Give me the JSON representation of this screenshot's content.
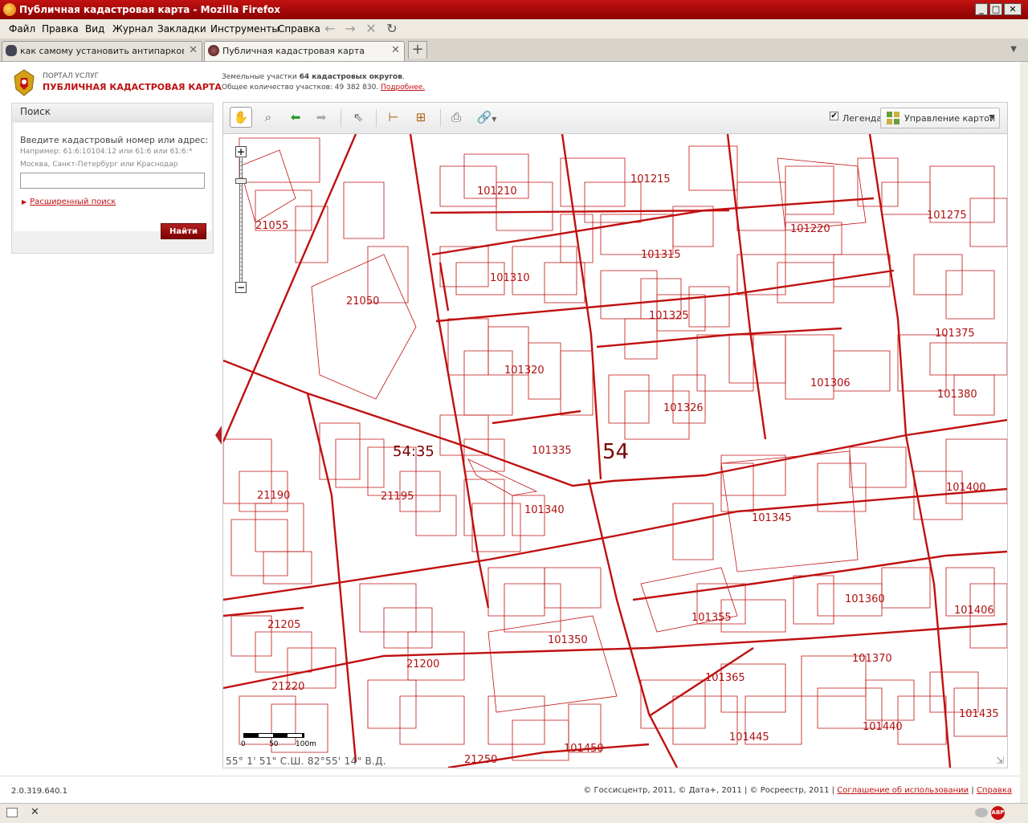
{
  "window": {
    "title": "Публичная кадастровая карта - Mozilla Firefox",
    "controls": [
      "_",
      "□",
      "✕"
    ]
  },
  "menu": {
    "items": [
      "Файл",
      "Правка",
      "Вид",
      "Журнал",
      "Закладки",
      "Инструменты",
      "Справка"
    ]
  },
  "address": {
    "url": "http://maps.rosreestr.ru/Portal/"
  },
  "tabs": [
    {
      "label": "как самому установить антипарковоч...",
      "active": false
    },
    {
      "label": "Публичная кадастровая карта",
      "active": true
    }
  ],
  "header": {
    "portal_line1": "ПОРТАЛ УСЛУГ",
    "portal_line2": "ПУБЛИЧНАЯ КАДАСТРОВАЯ КАРТА",
    "stats_prefix": "Земельные участки",
    "stats_bold": "64 кадастровых округов",
    "stats_suffix": ".",
    "count_text": "Общее количество участков: 49 382 830.",
    "details_link": "Подробнее."
  },
  "search": {
    "heading": "Поиск",
    "prompt": "Введите кадастровый номер или адрес:",
    "example1": "Например: 61:6:10104:12 или 61:6 или 61:6:*",
    "example2": "Москва, Санкт-Петербург или Краснодар",
    "input_value": "",
    "advanced_link": "Расширенный поиск",
    "submit_label": "Найти"
  },
  "toolbar": {
    "legend_label": "Легенда",
    "legend_checked": true,
    "legend_check_glyph": "✔",
    "map_control_label": "Управление картой",
    "tools": [
      {
        "name": "pan-tool",
        "glyph": "✋",
        "selected": true
      },
      {
        "name": "zoom-box-tool",
        "glyph": "⌕",
        "selected": false
      },
      {
        "name": "back-tool",
        "glyph": "⬅",
        "selected": false
      },
      {
        "name": "forward-tool",
        "glyph": "➡",
        "selected": false
      },
      {
        "name": "identify-tool",
        "glyph": "⇖",
        "selected": false
      },
      {
        "name": "measure-length-tool",
        "glyph": "⊢",
        "selected": false
      },
      {
        "name": "measure-area-tool",
        "glyph": "⊞",
        "selected": false
      },
      {
        "name": "print-tool",
        "glyph": "⎙",
        "selected": false
      },
      {
        "name": "link-tool",
        "glyph": "🔗",
        "selected": false
      }
    ]
  },
  "map": {
    "line_color": "#c01010",
    "district_label": "54",
    "area_label": "54:35",
    "block_labels": [
      "101210",
      "101215",
      "101220",
      "101275",
      "21055",
      "101315",
      "101310",
      "21050",
      "101325",
      "101375",
      "101320",
      "101306",
      "101326",
      "101380",
      "101335",
      "101400",
      "21190",
      "21195",
      "101340",
      "101345",
      "101350",
      "101355",
      "101360",
      "101406",
      "21205",
      "21200",
      "101370",
      "21220",
      "101365",
      "101435",
      "101445",
      "101440",
      "101450",
      "21250"
    ],
    "zoom_in": "+",
    "zoom_out": "−",
    "scale": {
      "zero": "0",
      "mid": "50",
      "end": "100m"
    },
    "coords": "55° 1' 51\"   С.Ш.   82°55' 14\"   В.Д."
  },
  "footer": {
    "version": "2.0.319.640.1",
    "copyright": "© Госсисцентр, 2011, © Дата+, 2011 | © Росреестр, 2011 |",
    "terms_link": "Соглашение об использовании",
    "sep": "|",
    "help_link": "Справка"
  },
  "status": {
    "abp": "ABP",
    "close": "✕"
  }
}
